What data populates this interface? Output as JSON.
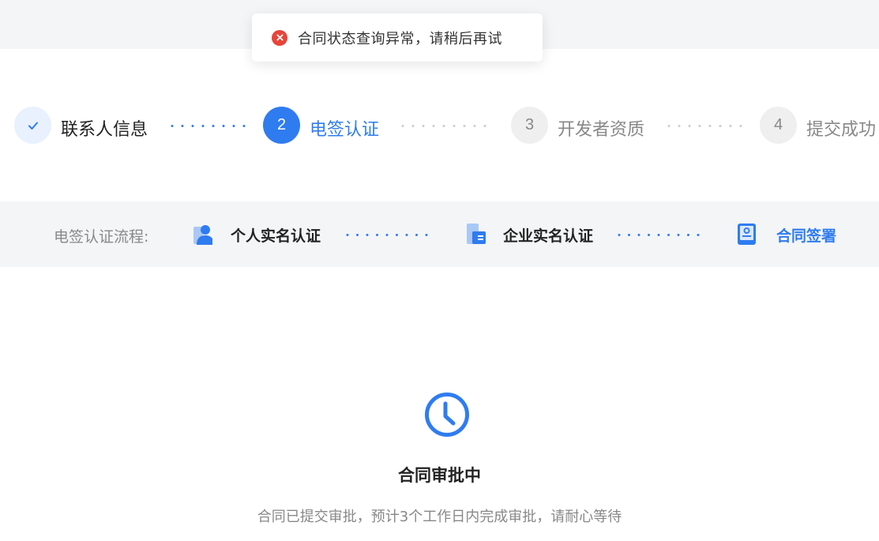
{
  "toast": {
    "icon": "error-circle-icon",
    "message": "合同状态查询异常，请稍后再试",
    "color": "#e8443a"
  },
  "steps": [
    {
      "number": "",
      "label": "联系人信息",
      "state": "done"
    },
    {
      "number": "2",
      "label": "电签认证",
      "state": "active"
    },
    {
      "number": "3",
      "label": "开发者资质",
      "state": "todo"
    },
    {
      "number": "4",
      "label": "提交成功",
      "state": "todo"
    }
  ],
  "flow": {
    "label": "电签认证流程:",
    "items": [
      {
        "label": "个人实名认证",
        "icon": "person-icon",
        "state": "done"
      },
      {
        "label": "企业实名认证",
        "icon": "building-icon",
        "state": "done"
      },
      {
        "label": "合同签署",
        "icon": "contract-icon",
        "state": "active"
      }
    ]
  },
  "status": {
    "icon": "clock-icon",
    "title": "合同审批中",
    "description": "合同已提交审批，预计3个工作日内完成审批，请耐心等待"
  },
  "colors": {
    "accent": "#2f7cf0",
    "error": "#e8443a",
    "muted": "#888888",
    "band": "#f4f5f7"
  }
}
